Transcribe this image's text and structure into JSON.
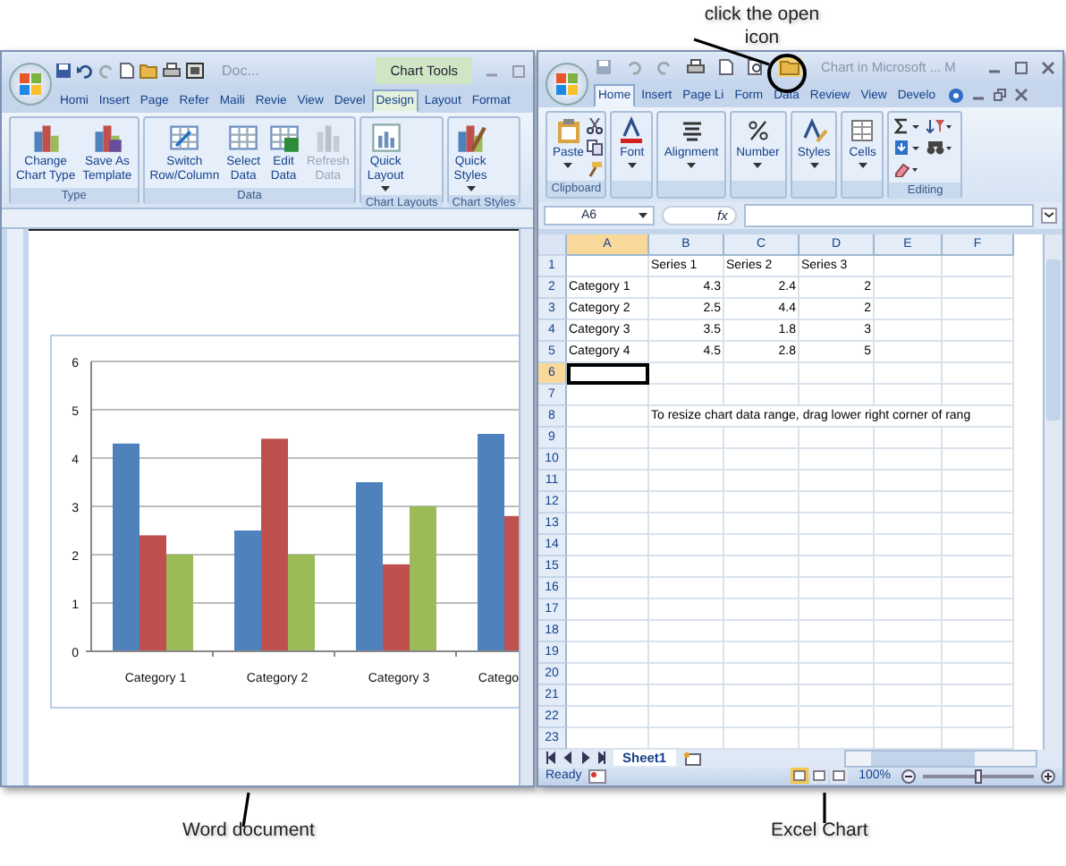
{
  "callouts": [
    {
      "text": "click the open icon"
    },
    {
      "text": "Word document"
    },
    {
      "text": "Excel Chart"
    }
  ],
  "word": {
    "title": "Doc...",
    "context_tab": "Chart Tools",
    "tabs": [
      {
        "label": "Homi",
        "selected": false
      },
      {
        "label": "Insert",
        "selected": false
      },
      {
        "label": "Page",
        "selected": false
      },
      {
        "label": "Refer",
        "selected": false
      },
      {
        "label": "Maili",
        "selected": false
      },
      {
        "label": "Revie",
        "selected": false
      },
      {
        "label": "View",
        "selected": false
      },
      {
        "label": "Devel",
        "selected": false
      },
      {
        "label": "Design",
        "selected": true
      },
      {
        "label": "Layout",
        "selected": false
      },
      {
        "label": "Format",
        "selected": false
      }
    ],
    "groups": [
      {
        "label": "Type",
        "buttons": [
          {
            "label": "Change\nChart Type",
            "disabled": false,
            "dropdown": false
          },
          {
            "label": "Save As\nTemplate",
            "disabled": false,
            "dropdown": false
          }
        ]
      },
      {
        "label": "Data",
        "buttons": [
          {
            "label": "Switch\nRow/Column",
            "disabled": false,
            "dropdown": false
          },
          {
            "label": "Select\nData",
            "disabled": false,
            "dropdown": false
          },
          {
            "label": "Edit\nData",
            "disabled": false,
            "dropdown": false
          },
          {
            "label": "Refresh\nData",
            "disabled": true,
            "dropdown": false
          }
        ]
      },
      {
        "label": "Chart Layouts",
        "buttons": [
          {
            "label": "Quick\nLayout",
            "disabled": false,
            "dropdown": true
          }
        ]
      },
      {
        "label": "Chart Styles",
        "buttons": [
          {
            "label": "Quick\nStyles",
            "disabled": false,
            "dropdown": true
          }
        ]
      }
    ],
    "chart_data": {
      "type": "bar",
      "categories": [
        "Category 1",
        "Category 2",
        "Category 3",
        "Catego"
      ],
      "series": [
        {
          "color": "#4f81bd",
          "values": [
            4.3,
            2.5,
            3.5,
            4.5
          ]
        },
        {
          "color": "#c0504d",
          "values": [
            2.4,
            4.4,
            1.8,
            2.8
          ]
        },
        {
          "color": "#9bbb59",
          "values": [
            2,
            2,
            3,
            null
          ]
        }
      ],
      "ylim": [
        0,
        6
      ],
      "yticks": [
        0,
        1,
        2,
        3,
        4,
        5,
        6
      ],
      "grid": true
    }
  },
  "excel": {
    "title": "Chart in Microsoft ... M",
    "tabs": [
      {
        "label": "Home",
        "selected": true
      },
      {
        "label": "Insert",
        "selected": false
      },
      {
        "label": "Page Li",
        "selected": false
      },
      {
        "label": "Form",
        "selected": false
      },
      {
        "label": "Data",
        "selected": false
      },
      {
        "label": "Review",
        "selected": false
      },
      {
        "label": "View",
        "selected": false
      },
      {
        "label": "Develo",
        "selected": false
      }
    ],
    "groups": [
      {
        "kind": "clipboard",
        "label": "Clipboard",
        "buttons": [
          {
            "label": "Paste",
            "dropdown": true
          }
        ]
      },
      {
        "kind": "command",
        "buttons": [
          {
            "label": "Font",
            "dropdown": true
          }
        ]
      },
      {
        "kind": "command",
        "buttons": [
          {
            "label": "Alignment",
            "dropdown": true
          }
        ]
      },
      {
        "kind": "command",
        "buttons": [
          {
            "label": "Number",
            "dropdown": true
          }
        ]
      },
      {
        "kind": "command",
        "buttons": [
          {
            "label": "Styles",
            "dropdown": true
          }
        ]
      },
      {
        "kind": "command",
        "buttons": [
          {
            "label": "Cells",
            "dropdown": true
          }
        ]
      },
      {
        "kind": "editing",
        "label": "Editing"
      }
    ],
    "name_box": "A6",
    "formula_label": "fx",
    "columns": [
      {
        "label": "A",
        "selected": true
      },
      {
        "label": "B",
        "selected": false
      },
      {
        "label": "C",
        "selected": false
      },
      {
        "label": "D",
        "selected": false
      },
      {
        "label": "E",
        "selected": false
      },
      {
        "label": "F",
        "selected": false
      }
    ],
    "rows": [
      {
        "number": "1",
        "selected": false,
        "cells": [
          null,
          {
            "text": "Series 1",
            "kind": "text"
          },
          {
            "text": "Series 2",
            "kind": "text"
          },
          {
            "text": "Series 3",
            "kind": "text"
          },
          null,
          null
        ]
      },
      {
        "number": "2",
        "selected": false,
        "cells": [
          {
            "text": "Category 1",
            "kind": "text"
          },
          {
            "text": "4.3",
            "kind": "number"
          },
          {
            "text": "2.4",
            "kind": "number"
          },
          {
            "text": "2",
            "kind": "number"
          },
          null,
          null
        ]
      },
      {
        "number": "3",
        "selected": false,
        "cells": [
          {
            "text": "Category 2",
            "kind": "text"
          },
          {
            "text": "2.5",
            "kind": "number"
          },
          {
            "text": "4.4",
            "kind": "number"
          },
          {
            "text": "2",
            "kind": "number"
          },
          null,
          null
        ]
      },
      {
        "number": "4",
        "selected": false,
        "cells": [
          {
            "text": "Category 3",
            "kind": "text"
          },
          {
            "text": "3.5",
            "kind": "number"
          },
          {
            "text": "1.8",
            "kind": "number"
          },
          {
            "text": "3",
            "kind": "number"
          },
          null,
          null
        ]
      },
      {
        "number": "5",
        "selected": false,
        "cells": [
          {
            "text": "Category 4",
            "kind": "text"
          },
          {
            "text": "4.5",
            "kind": "number"
          },
          {
            "text": "2.8",
            "kind": "number"
          },
          {
            "text": "5",
            "kind": "number"
          },
          null,
          null
        ]
      },
      {
        "number": "6",
        "selected": true
      },
      {
        "number": "7",
        "selected": false
      },
      {
        "number": "8",
        "selected": false,
        "cells": [
          null,
          {
            "text": "To resize chart data range, drag lower right corner of rang",
            "kind": "overflow"
          },
          null,
          null,
          null,
          null
        ]
      },
      {
        "number": "9",
        "selected": false
      },
      {
        "number": "10",
        "selected": false
      },
      {
        "number": "11",
        "selected": false
      },
      {
        "number": "12",
        "selected": false
      },
      {
        "number": "13",
        "selected": false
      },
      {
        "number": "14",
        "selected": false
      },
      {
        "number": "15",
        "selected": false
      },
      {
        "number": "16",
        "selected": false
      },
      {
        "number": "17",
        "selected": false
      },
      {
        "number": "18",
        "selected": false
      },
      {
        "number": "19",
        "selected": false
      },
      {
        "number": "20",
        "selected": false
      },
      {
        "number": "21",
        "selected": false
      },
      {
        "number": "22",
        "selected": false
      },
      {
        "number": "23",
        "selected": false
      }
    ],
    "sheets": [
      {
        "label": "Sheet1",
        "selected": true
      }
    ],
    "status": "Ready",
    "views": [
      {
        "selected": true
      },
      {
        "selected": false
      },
      {
        "selected": false
      }
    ],
    "zoom": {
      "label": "100%",
      "level": 0.5
    }
  }
}
